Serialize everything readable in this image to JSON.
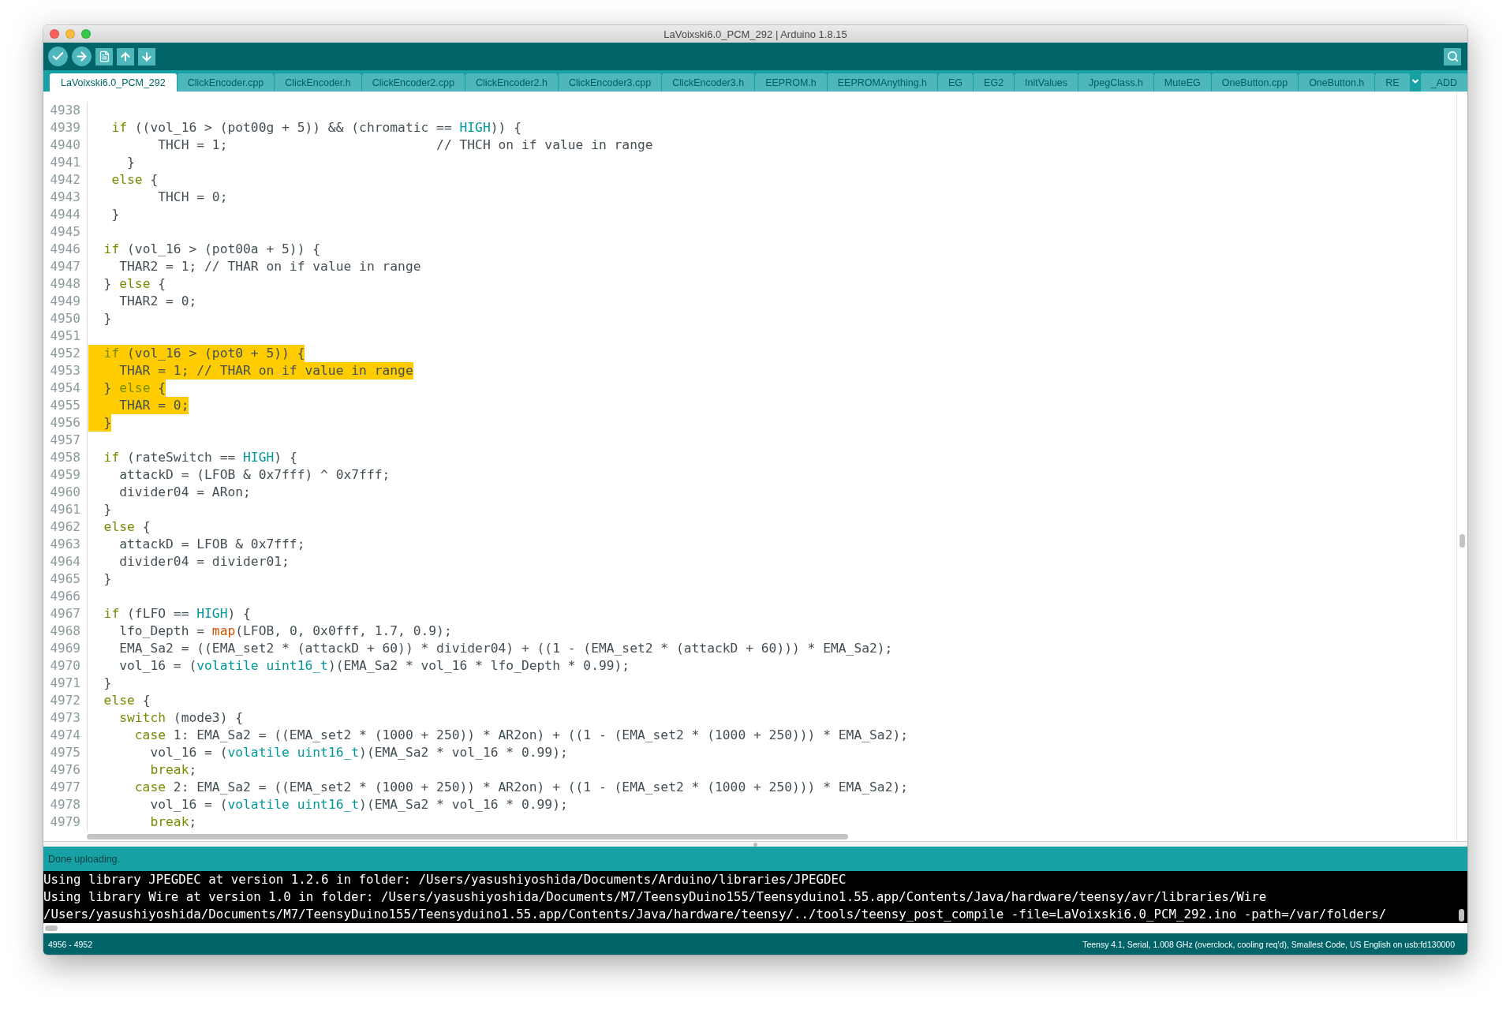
{
  "window": {
    "title": "LaVoixski6.0_PCM_292 | Arduino 1.8.15"
  },
  "tabs": [
    {
      "label": "LaVoixski6.0_PCM_292",
      "selected": true
    },
    {
      "label": "ClickEncoder.cpp",
      "selected": false
    },
    {
      "label": "ClickEncoder.h",
      "selected": false
    },
    {
      "label": "ClickEncoder2.cpp",
      "selected": false
    },
    {
      "label": "ClickEncoder2.h",
      "selected": false
    },
    {
      "label": "ClickEncoder3.cpp",
      "selected": false
    },
    {
      "label": "ClickEncoder3.h",
      "selected": false
    },
    {
      "label": "EEPROM.h",
      "selected": false
    },
    {
      "label": "EEPROMAnything.h",
      "selected": false
    },
    {
      "label": "EG",
      "selected": false
    },
    {
      "label": "EG2",
      "selected": false
    },
    {
      "label": "InitValues",
      "selected": false
    },
    {
      "label": "JpegClass.h",
      "selected": false
    },
    {
      "label": "MuteEG",
      "selected": false
    },
    {
      "label": "OneButton.cpp",
      "selected": false
    },
    {
      "label": "OneButton.h",
      "selected": false
    },
    {
      "label": "RE",
      "selected": false
    },
    {
      "label": "_ADD",
      "selected": false
    }
  ],
  "editor": {
    "lines": [
      {
        "number": "4938",
        "selected": false
      },
      {
        "number": "4939",
        "selected": false,
        "segments": [
          {
            "kind": "keyword",
            "text": "   if"
          },
          {
            "kind": "plain",
            "text": " ((vol_16 > (pot00g + 5)) && (chromatic == "
          },
          {
            "kind": "constant",
            "text": "HIGH"
          },
          {
            "kind": "plain",
            "text": ")) {"
          }
        ]
      },
      {
        "number": "4940",
        "selected": false,
        "segments": [
          {
            "kind": "plain",
            "text": "         THCH = 1;                           "
          },
          {
            "kind": "comment",
            "text": "// THCH on if value in range"
          }
        ]
      },
      {
        "number": "4941",
        "selected": false,
        "segments": [
          {
            "kind": "plain",
            "text": "     }"
          }
        ]
      },
      {
        "number": "4942",
        "selected": false,
        "segments": [
          {
            "kind": "keyword",
            "text": "   else"
          },
          {
            "kind": "plain",
            "text": " {"
          }
        ]
      },
      {
        "number": "4943",
        "selected": false,
        "segments": [
          {
            "kind": "plain",
            "text": "         THCH = 0;"
          }
        ]
      },
      {
        "number": "4944",
        "selected": false,
        "segments": [
          {
            "kind": "plain",
            "text": "   }"
          }
        ]
      },
      {
        "number": "4945",
        "selected": false
      },
      {
        "number": "4946",
        "selected": false,
        "segments": [
          {
            "kind": "keyword",
            "text": "  if"
          },
          {
            "kind": "plain",
            "text": " (vol_16 > (pot00a + 5)) {"
          }
        ]
      },
      {
        "number": "4947",
        "selected": false,
        "segments": [
          {
            "kind": "plain",
            "text": "    THAR2 = 1; "
          },
          {
            "kind": "comment",
            "text": "// THAR on if value in range"
          }
        ]
      },
      {
        "number": "4948",
        "selected": false,
        "segments": [
          {
            "kind": "plain",
            "text": "  } "
          },
          {
            "kind": "keyword",
            "text": "else"
          },
          {
            "kind": "plain",
            "text": " {"
          }
        ]
      },
      {
        "number": "4949",
        "selected": false,
        "segments": [
          {
            "kind": "plain",
            "text": "    THAR2 = 0;"
          }
        ]
      },
      {
        "number": "4950",
        "selected": false,
        "segments": [
          {
            "kind": "plain",
            "text": "  }"
          }
        ]
      },
      {
        "number": "4951",
        "selected": false
      },
      {
        "number": "4952",
        "selected": true,
        "segments": [
          {
            "kind": "keyword",
            "text": "  if"
          },
          {
            "kind": "plain",
            "text": " (vol_16 > (pot0 + 5)) {"
          }
        ]
      },
      {
        "number": "4953",
        "selected": true,
        "segments": [
          {
            "kind": "plain",
            "text": "    THAR = 1; "
          },
          {
            "kind": "comment",
            "text": "// THAR on if value in range"
          }
        ]
      },
      {
        "number": "4954",
        "selected": true,
        "segments": [
          {
            "kind": "plain",
            "text": "  } "
          },
          {
            "kind": "keyword",
            "text": "else"
          },
          {
            "kind": "plain",
            "text": " {"
          }
        ]
      },
      {
        "number": "4955",
        "selected": true,
        "segments": [
          {
            "kind": "plain",
            "text": "    THAR = 0;"
          }
        ]
      },
      {
        "number": "4956",
        "selected": true,
        "segments": [
          {
            "kind": "plain",
            "text": "  }"
          }
        ]
      },
      {
        "number": "4957",
        "selected": false
      },
      {
        "number": "4958",
        "selected": false,
        "segments": [
          {
            "kind": "keyword",
            "text": "  if"
          },
          {
            "kind": "plain",
            "text": " (rateSwitch == "
          },
          {
            "kind": "constant",
            "text": "HIGH"
          },
          {
            "kind": "plain",
            "text": ") {"
          }
        ]
      },
      {
        "number": "4959",
        "selected": false,
        "segments": [
          {
            "kind": "plain",
            "text": "    attackD = (LFOB & 0x7fff) ^ 0x7fff;"
          }
        ]
      },
      {
        "number": "4960",
        "selected": false,
        "segments": [
          {
            "kind": "plain",
            "text": "    divider04 = ARon;"
          }
        ]
      },
      {
        "number": "4961",
        "selected": false,
        "segments": [
          {
            "kind": "plain",
            "text": "  }"
          }
        ]
      },
      {
        "number": "4962",
        "selected": false,
        "segments": [
          {
            "kind": "keyword",
            "text": "  else"
          },
          {
            "kind": "plain",
            "text": " {"
          }
        ]
      },
      {
        "number": "4963",
        "selected": false,
        "segments": [
          {
            "kind": "plain",
            "text": "    attackD = LFOB & 0x7fff;"
          }
        ]
      },
      {
        "number": "4964",
        "selected": false,
        "segments": [
          {
            "kind": "plain",
            "text": "    divider04 = divider01;"
          }
        ]
      },
      {
        "number": "4965",
        "selected": false,
        "segments": [
          {
            "kind": "plain",
            "text": "  }"
          }
        ]
      },
      {
        "number": "4966",
        "selected": false
      },
      {
        "number": "4967",
        "selected": false,
        "segments": [
          {
            "kind": "keyword",
            "text": "  if"
          },
          {
            "kind": "plain",
            "text": " (fLFO == "
          },
          {
            "kind": "constant",
            "text": "HIGH"
          },
          {
            "kind": "plain",
            "text": ") {"
          }
        ]
      },
      {
        "number": "4968",
        "selected": false,
        "segments": [
          {
            "kind": "plain",
            "text": "    lfo_Depth = "
          },
          {
            "kind": "function",
            "text": "map"
          },
          {
            "kind": "plain",
            "text": "(LFOB, 0, 0x0fff, 1.7, 0.9);"
          }
        ]
      },
      {
        "number": "4969",
        "selected": false,
        "segments": [
          {
            "kind": "plain",
            "text": "    EMA_Sa2 = ((EMA_set2 * (attackD + 60)) * divider04) + ((1 - (EMA_set2 * (attackD + 60))) * EMA_Sa2);"
          }
        ]
      },
      {
        "number": "4970",
        "selected": false,
        "segments": [
          {
            "kind": "plain",
            "text": "    vol_16 = ("
          },
          {
            "kind": "type",
            "text": "volatile uint16_t"
          },
          {
            "kind": "plain",
            "text": ")(EMA_Sa2 * vol_16 * lfo_Depth * 0.99);"
          }
        ]
      },
      {
        "number": "4971",
        "selected": false,
        "segments": [
          {
            "kind": "plain",
            "text": "  }"
          }
        ]
      },
      {
        "number": "4972",
        "selected": false,
        "segments": [
          {
            "kind": "keyword",
            "text": "  else"
          },
          {
            "kind": "plain",
            "text": " {"
          }
        ]
      },
      {
        "number": "4973",
        "selected": false,
        "segments": [
          {
            "kind": "keyword",
            "text": "    switch"
          },
          {
            "kind": "plain",
            "text": " (mode3) {"
          }
        ]
      },
      {
        "number": "4974",
        "selected": false,
        "segments": [
          {
            "kind": "keyword",
            "text": "      case"
          },
          {
            "kind": "plain",
            "text": " 1: EMA_Sa2 = ((EMA_set2 * (1000 + 250)) * AR2on) + ((1 - (EMA_set2 * (1000 + 250))) * EMA_Sa2);"
          }
        ]
      },
      {
        "number": "4975",
        "selected": false,
        "segments": [
          {
            "kind": "plain",
            "text": "        vol_16 = ("
          },
          {
            "kind": "type",
            "text": "volatile uint16_t"
          },
          {
            "kind": "plain",
            "text": ")(EMA_Sa2 * vol_16 * 0.99);"
          }
        ]
      },
      {
        "number": "4976",
        "selected": false,
        "segments": [
          {
            "kind": "keyword",
            "text": "        break"
          },
          {
            "kind": "plain",
            "text": ";"
          }
        ]
      },
      {
        "number": "4977",
        "selected": false,
        "segments": [
          {
            "kind": "keyword",
            "text": "      case"
          },
          {
            "kind": "plain",
            "text": " 2: EMA_Sa2 = ((EMA_set2 * (1000 + 250)) * AR2on) + ((1 - (EMA_set2 * (1000 + 250))) * EMA_Sa2);"
          }
        ]
      },
      {
        "number": "4978",
        "selected": false,
        "segments": [
          {
            "kind": "plain",
            "text": "        vol_16 = ("
          },
          {
            "kind": "type",
            "text": "volatile uint16_t"
          },
          {
            "kind": "plain",
            "text": ")(EMA_Sa2 * vol_16 * 0.99);"
          }
        ]
      },
      {
        "number": "4979",
        "selected": false,
        "segments": [
          {
            "kind": "keyword",
            "text": "        break"
          },
          {
            "kind": "plain",
            "text": ";"
          }
        ]
      }
    ]
  },
  "message": "Done uploading.",
  "console": {
    "lines": [
      "Using library JPEGDEC at version 1.2.6 in folder: /Users/yasushiyoshida/Documents/Arduino/libraries/JPEGDEC",
      "Using library Wire at version 1.0 in folder: /Users/yasushiyoshida/Documents/M7/TeensyDuino155/Teensyduino1.55.app/Contents/Java/hardware/teensy/avr/libraries/Wire",
      "/Users/yasushiyoshida/Documents/M7/TeensyDuino155/Teensyduino1.55.app/Contents/Java/hardware/teensy/../tools/teensy_post_compile -file=LaVoixski6.0_PCM_292.ino -path=/var/folders/"
    ]
  },
  "status_bar": {
    "line_range": "4956 - 4952",
    "board": "Teensy 4.1, Serial, 1.008 GHz (overclock, cooling req'd), Smallest Code, US English on usb:fd130000"
  }
}
